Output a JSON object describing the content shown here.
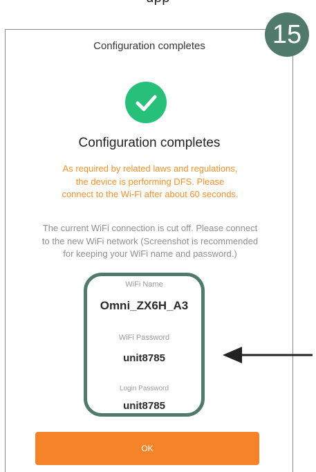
{
  "top_cropped_text": "upp",
  "step_badge": "15",
  "header": {
    "title": "Configuration completes"
  },
  "status": {
    "icon": "checkmark-icon",
    "icon_color": "#27c07a",
    "title": "Configuration completes",
    "orange_notice": "As required by related laws and regulations, the device is performing DFS. Please connect to the Wi-Fi after about 60 seconds.",
    "grey_notice": "The current WiFi connection is cut off. Please connect to the new WiFi network (Screenshot is recommended for keeping your WiFi name and password.)"
  },
  "wifi_info": {
    "wifi_name_label": "WiFi Name",
    "wifi_name_value": "Omni_ZX6H_A3",
    "wifi_password_label": "WiFi Password",
    "wifi_password_value": "unit8785",
    "login_password_label": "Login Password",
    "login_password_value": "unit8785"
  },
  "actions": {
    "ok_label": "OK",
    "ok_color": "#f5832a"
  },
  "annotation": {
    "highlight_color": "#4f7a6c",
    "arrow_icon": "left-arrow-icon"
  }
}
